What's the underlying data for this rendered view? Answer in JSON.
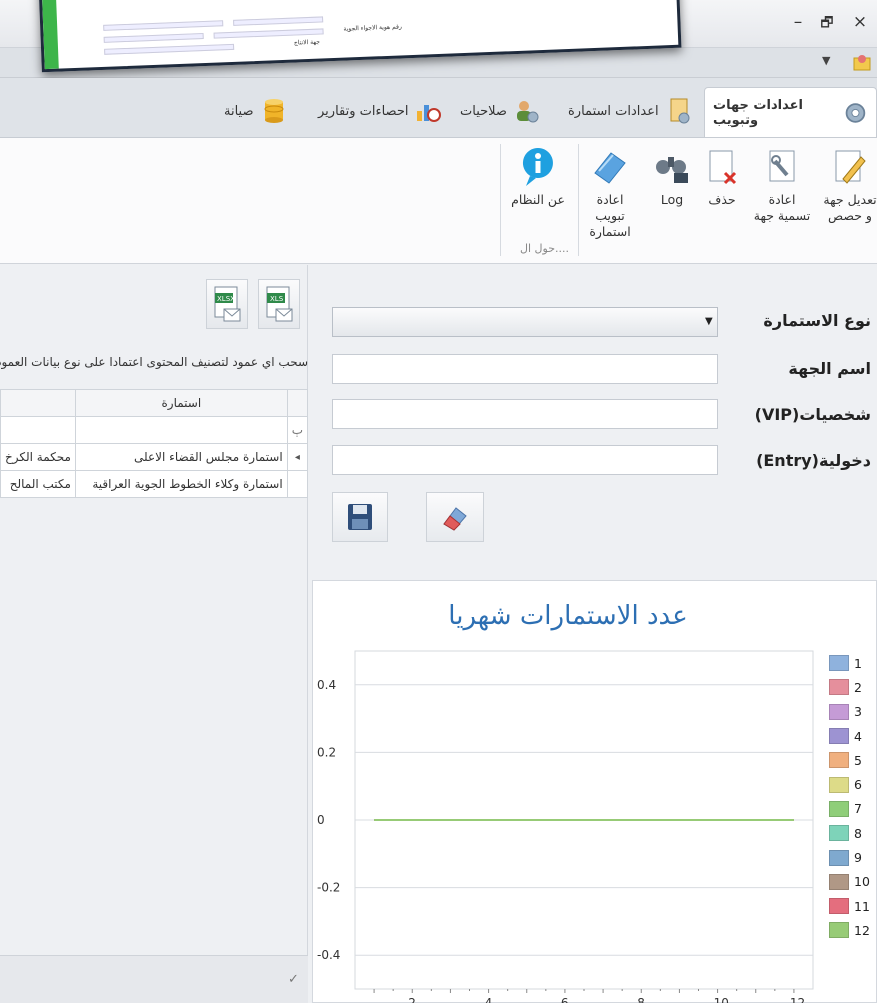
{
  "window": {
    "minimize": "–",
    "restore": "🗗",
    "close": "×"
  },
  "overlay": {
    "line1": "رقم هوية الاجواء الجوية",
    "line2": "جهة الانتاج"
  },
  "tabs": [
    {
      "label": "اعدادات جهات وتبويب",
      "icon": "gear-icon",
      "active": true
    },
    {
      "label": "اعدادات استمارة",
      "icon": "form-settings-icon",
      "active": false
    },
    {
      "label": "صلاحيات",
      "icon": "users-icon",
      "active": false
    },
    {
      "label": "احصاءات وتقارير",
      "icon": "report-chart-icon",
      "active": false
    },
    {
      "label": "صيانة",
      "icon": "database-icon",
      "active": false
    }
  ],
  "ribbon": {
    "buttons": [
      {
        "label": "تعديل جهة و حصص",
        "icon": "edit-pencil-icon"
      },
      {
        "label": "اعادة تسمية جهة",
        "icon": "rename-wrench-icon"
      },
      {
        "label": "حذف",
        "icon": "delete-doc-icon"
      },
      {
        "label": "Log",
        "icon": "binoculars-icon"
      },
      {
        "label": "اعادة تبويب استمارة",
        "icon": "rearrange-icon"
      },
      {
        "label": "عن النظام",
        "icon": "info-icon"
      }
    ],
    "group_label": "حول ال...."
  },
  "form": {
    "form_type_label": "نوع الاستمارة",
    "entity_name_label": "اسم الجهة",
    "vip_label": "شخصيات(VIP)",
    "entry_label": "دخولية(Entry)",
    "form_type_value": "",
    "entity_name_value": "",
    "vip_value": "",
    "entry_value": ""
  },
  "grid": {
    "hint": "سحب اي عمود لتصنيف المحتوى اعتمادا على نوع بيانات العمود",
    "columns": [
      "استمارة",
      ""
    ],
    "filter_symbol": "ٻ",
    "rows": [
      {
        "form": "استمارة مجلس القضاء الاعلى",
        "entity": "محكمة الكرخ",
        "selected": true
      },
      {
        "form": "استمارة وكلاء الخطوط الجوية العراقية",
        "entity": "مكتب المالح",
        "selected": false
      }
    ],
    "row_indicator": "◂",
    "footer_check": "✓"
  },
  "chart_data": {
    "type": "line",
    "title": "عدد الاستمارات شهريا",
    "x": [
      1,
      2,
      3,
      4,
      5,
      6,
      7,
      8,
      9,
      10,
      11,
      12
    ],
    "xticks": [
      2,
      4,
      6,
      8,
      10,
      12
    ],
    "yticks": [
      -0.4,
      -0.2,
      0,
      0.2,
      0.4
    ],
    "ylim": [
      -0.5,
      0.5
    ],
    "xlim": [
      0.5,
      12.5
    ],
    "grid": true,
    "legend_position": "right",
    "series": [
      {
        "name": "1",
        "color": "#8fb2dd",
        "values": [
          0,
          0,
          0,
          0,
          0,
          0,
          0,
          0,
          0,
          0,
          0,
          0
        ]
      },
      {
        "name": "2",
        "color": "#e58f9c",
        "values": [
          0,
          0,
          0,
          0,
          0,
          0,
          0,
          0,
          0,
          0,
          0,
          0
        ]
      },
      {
        "name": "3",
        "color": "#c59bd6",
        "values": [
          0,
          0,
          0,
          0,
          0,
          0,
          0,
          0,
          0,
          0,
          0,
          0
        ]
      },
      {
        "name": "4",
        "color": "#9d93d2",
        "values": [
          0,
          0,
          0,
          0,
          0,
          0,
          0,
          0,
          0,
          0,
          0,
          0
        ]
      },
      {
        "name": "5",
        "color": "#f0b07f",
        "values": [
          0,
          0,
          0,
          0,
          0,
          0,
          0,
          0,
          0,
          0,
          0,
          0
        ]
      },
      {
        "name": "6",
        "color": "#dddb88",
        "values": [
          0,
          0,
          0,
          0,
          0,
          0,
          0,
          0,
          0,
          0,
          0,
          0
        ]
      },
      {
        "name": "7",
        "color": "#8fce79",
        "values": [
          0,
          0,
          0,
          0,
          0,
          0,
          0,
          0,
          0,
          0,
          0,
          0
        ]
      },
      {
        "name": "8",
        "color": "#7ed3b9",
        "values": [
          0,
          0,
          0,
          0,
          0,
          0,
          0,
          0,
          0,
          0,
          0,
          0
        ]
      },
      {
        "name": "9",
        "color": "#7fa9cf",
        "values": [
          0,
          0,
          0,
          0,
          0,
          0,
          0,
          0,
          0,
          0,
          0,
          0
        ]
      },
      {
        "name": "10",
        "color": "#b09886",
        "values": [
          0,
          0,
          0,
          0,
          0,
          0,
          0,
          0,
          0,
          0,
          0,
          0
        ]
      },
      {
        "name": "11",
        "color": "#e46e7e",
        "values": [
          0,
          0,
          0,
          0,
          0,
          0,
          0,
          0,
          0,
          0,
          0,
          0
        ]
      },
      {
        "name": "12",
        "color": "#97cb76",
        "values": [
          0,
          0,
          0,
          0,
          0,
          0,
          0,
          0,
          0,
          0,
          0,
          0
        ]
      }
    ]
  }
}
